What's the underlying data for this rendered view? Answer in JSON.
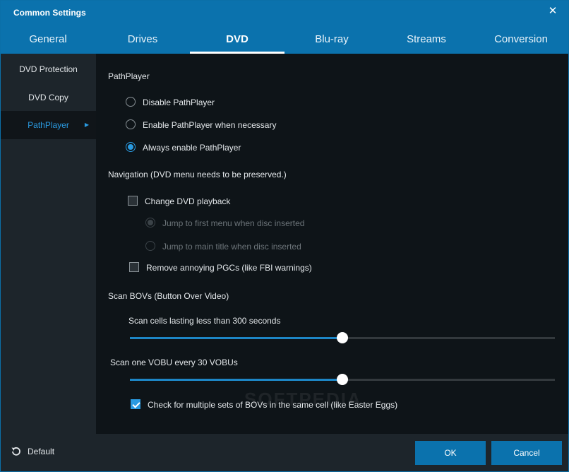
{
  "window": {
    "title": "Common Settings"
  },
  "tabs": [
    {
      "label": "General"
    },
    {
      "label": "Drives"
    },
    {
      "label": "DVD"
    },
    {
      "label": "Blu-ray"
    },
    {
      "label": "Streams"
    },
    {
      "label": "Conversion"
    }
  ],
  "active_tab": "DVD",
  "sidebar": {
    "items": [
      {
        "label": "DVD Protection"
      },
      {
        "label": "DVD Copy"
      },
      {
        "label": "PathPlayer"
      }
    ],
    "active": "PathPlayer"
  },
  "pathplayer": {
    "heading": "PathPlayer",
    "options": [
      {
        "label": "Disable PathPlayer",
        "checked": false
      },
      {
        "label": "Enable PathPlayer when necessary",
        "checked": false
      },
      {
        "label": "Always enable PathPlayer",
        "checked": true
      }
    ]
  },
  "navigation": {
    "heading": "Navigation (DVD menu needs to be preserved.)",
    "change_playback": {
      "label": "Change DVD playback",
      "checked": false
    },
    "jump_first_menu": {
      "label": "Jump to first menu when disc inserted",
      "checked": true,
      "enabled": false
    },
    "jump_main_title": {
      "label": "Jump to main title when disc inserted",
      "checked": false,
      "enabled": false
    },
    "remove_pgcs": {
      "label": "Remove annoying PGCs (like FBI warnings)",
      "checked": false
    }
  },
  "scan_bovs": {
    "heading": "Scan BOVs (Button Over Video)",
    "cells_label": "Scan cells lasting less than 300 seconds",
    "cells_fraction": 0.5,
    "vobu_label": "Scan one VOBU every 30 VOBUs",
    "vobu_fraction": 0.5,
    "multiple_sets": {
      "label": "Check for multiple sets of BOVs in the same cell (like Easter Eggs)",
      "checked": true
    }
  },
  "watermark": "SOFTPEDIA",
  "footer": {
    "default_label": "Default",
    "ok_label": "OK",
    "cancel_label": "Cancel"
  },
  "colors": {
    "accent": "#0b72ad",
    "highlight": "#2a9ae0",
    "background": "#0e1418",
    "panel": "#1d252b"
  }
}
